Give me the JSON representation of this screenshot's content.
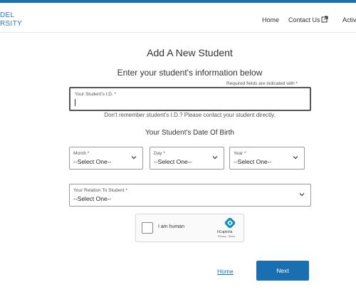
{
  "header": {
    "logo_line1": "DEL",
    "logo_line2": "RSITY",
    "nav": {
      "home": "Home",
      "contact": "Contact Us",
      "activities": "Activi"
    }
  },
  "form": {
    "title": "Add A New Student",
    "subtitle": "Enter your student's information below",
    "required_note": "Required fields are indicated with *",
    "student_id": {
      "label": "Your Student's I.D. *",
      "value": ""
    },
    "id_hint": "Don't remember student's I.D.? Please contact your student directly.",
    "dob_heading": "Your Student's Date Of Birth",
    "month": {
      "label": "Month *",
      "value": "--Select One--"
    },
    "day": {
      "label": "Day *",
      "value": "--Select One--"
    },
    "year": {
      "label": "Year *",
      "value": "--Select One--"
    },
    "relation": {
      "label": "Your Relation To Student *",
      "value": "--Select One--"
    }
  },
  "captcha": {
    "label": "I am human",
    "brand": "hCaptcha",
    "links": "Privacy - Terms"
  },
  "actions": {
    "home_link": "Home",
    "next_button": "Next"
  },
  "colors": {
    "accent": "#1a6fb0"
  }
}
